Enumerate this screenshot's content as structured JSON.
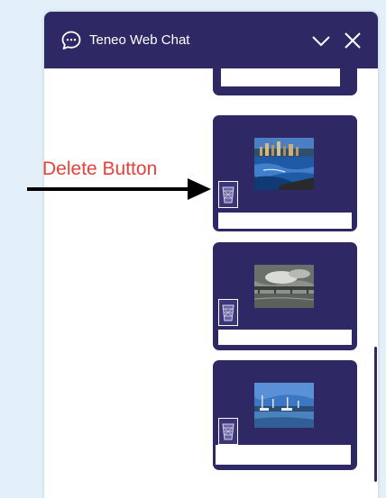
{
  "header": {
    "title": "Teneo Web Chat",
    "icons": {
      "chat": "chat-bubble-icon",
      "minimize": "chevron-down-icon",
      "close": "close-icon"
    }
  },
  "cards": [
    {
      "name": "partial-image-card",
      "image": "partial"
    },
    {
      "name": "image-card-city-skyline",
      "image": "city-skyline-over-water"
    },
    {
      "name": "image-card-bridge",
      "image": "bridge-over-river-cloudy-sky"
    },
    {
      "name": "image-card-harbor",
      "image": "harbor-with-boats"
    }
  ],
  "annotation": {
    "label": "Delete Button",
    "color": "#e8403a"
  },
  "colors": {
    "brand": "#2e2865",
    "background": "#e3f0fa"
  }
}
